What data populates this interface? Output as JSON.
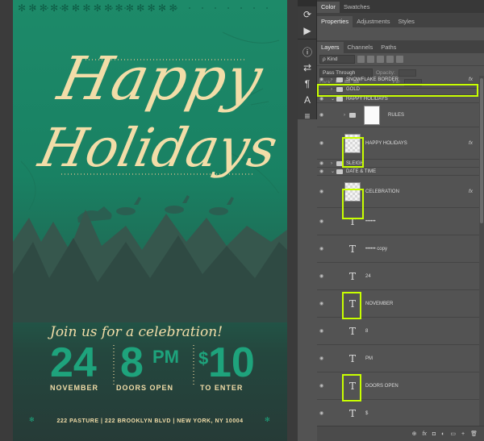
{
  "poster": {
    "script_line1": "Happy",
    "script_line2": "Holidays",
    "celebration": "Join us for a celebration!",
    "day": "24",
    "hour": "8",
    "ampm": "PM",
    "currency": "$",
    "price": "10",
    "month_label": "NOVEMBER",
    "doors_label": "DOORS OPEN",
    "enter_label": "TO ENTER",
    "address": "222 PASTURE | 222 BROOKLYN BLVD | NEW YORK, NY 10004",
    "colors": {
      "green": "#198163",
      "dark": "#263b37",
      "cream": "#f2dda8",
      "teal_text": "#1ea37c"
    }
  },
  "tools": [
    "history-icon",
    "play-icon",
    "info-icon",
    "swap-icon",
    "paragraph-icon",
    "character-icon",
    "text-panel-icon"
  ],
  "tool_glyphs": [
    "⟳",
    "▶",
    "ⓘ",
    "⇄",
    "¶",
    "A",
    "≡"
  ],
  "tabs_top": {
    "t1": "Color",
    "t2": "Swatches"
  },
  "tabs_mid": {
    "t1": "Properties",
    "t2": "Adjustments",
    "t3": "Styles"
  },
  "tabs_layers": {
    "t1": "Layers",
    "t2": "Channels",
    "t3": "Paths"
  },
  "layers_panel": {
    "filter_kind": "ρ Kind",
    "blend_mode": "Pass Through",
    "opacity_label": "Opacity:",
    "lock_label": "Lock:",
    "fill_label": "Fill:",
    "highlight_color": "#c8ff00"
  },
  "layers": [
    {
      "name": "SNOWFLAKE BORDER",
      "fx": "fx"
    },
    {
      "name": "GOLD"
    },
    {
      "name": "HAPPY HOLIDAYS"
    },
    {
      "name": "RULES"
    },
    {
      "name": "HAPPY HOLIDAYS",
      "fx": "fx"
    },
    {
      "name": "SLEIGH"
    },
    {
      "name": "DATE & TIME"
    },
    {
      "name": "CELEBRATION",
      "fx": "fx"
    },
    {
      "name": "••••••"
    },
    {
      "name": "•••••• copy"
    },
    {
      "name": "24"
    },
    {
      "name": "NOVEMBER"
    },
    {
      "name": "8"
    },
    {
      "name": "PM"
    },
    {
      "name": "DOORS OPEN"
    },
    {
      "name": "$"
    }
  ],
  "footer_icons": {
    "link": "⊕",
    "fx": "fx",
    "mask": "◘",
    "adjust": "◐",
    "folder": "▭",
    "new": "+",
    "trash": "🗑"
  }
}
